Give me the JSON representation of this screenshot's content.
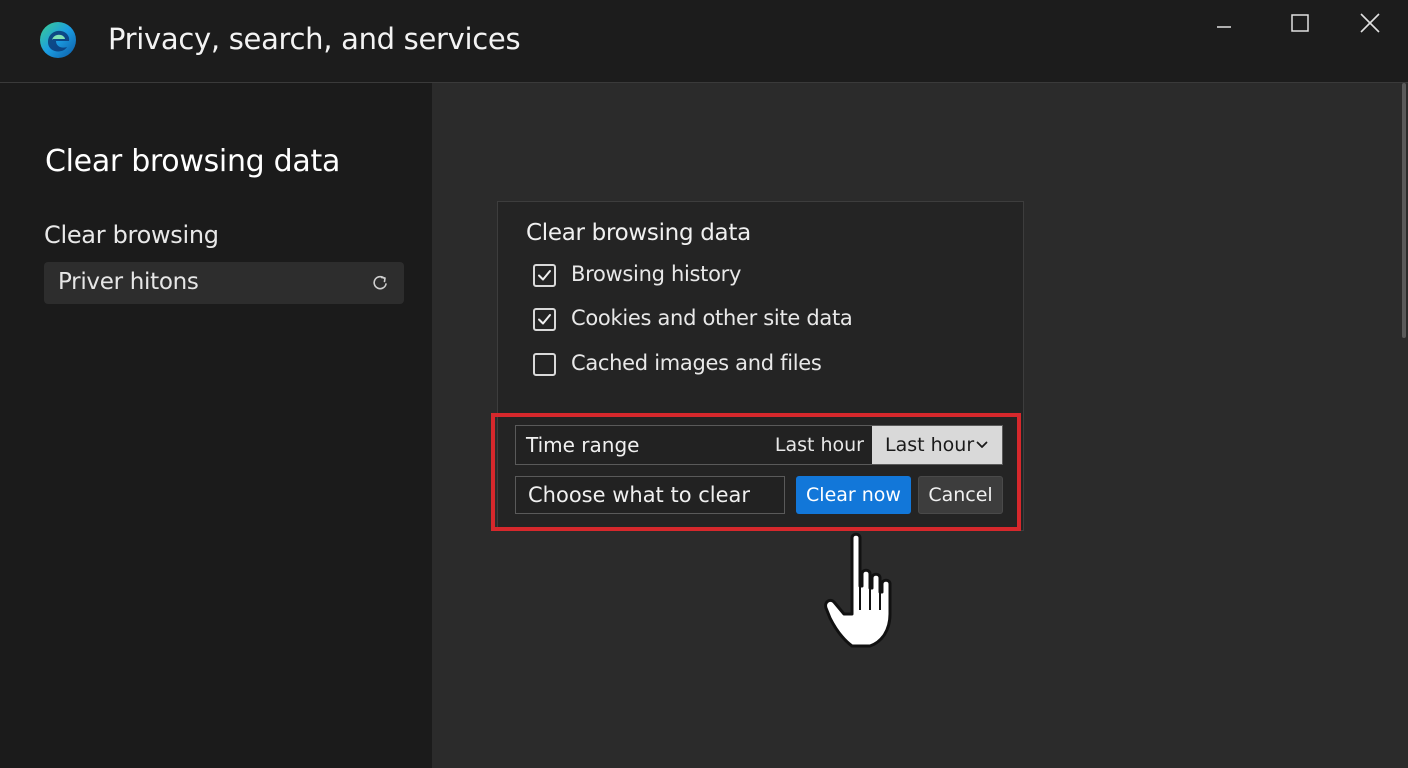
{
  "window": {
    "title": "Privacy, search, and services"
  },
  "icons": {
    "app": "edge-logo-icon",
    "minimize": "minimize-icon",
    "maximize": "maximize-icon",
    "close": "close-icon",
    "refresh": "refresh-icon",
    "checkmark": "checkmark-icon",
    "chevron": "chevron-down-icon",
    "pointer": "hand-pointer-icon"
  },
  "sidebar": {
    "heading": "Clear browsing data",
    "subheading": "Clear browsing",
    "item_label": "Priver hitons"
  },
  "dialog": {
    "title": "Clear browsing data",
    "options": [
      {
        "label": "Browsing history",
        "checked": true
      },
      {
        "label": "Cookies and other site data",
        "checked": true
      },
      {
        "label": "Cached images and files",
        "checked": false
      }
    ],
    "time_range": {
      "label": "Time range",
      "value": "Last hour",
      "selected": "Last hour"
    },
    "choose_label": "Choose what to clear",
    "clear_button": "Clear now",
    "cancel_button": "Cancel"
  },
  "colors": {
    "accent": "#1277d9",
    "highlight": "#d6282c",
    "background": "#202020"
  }
}
